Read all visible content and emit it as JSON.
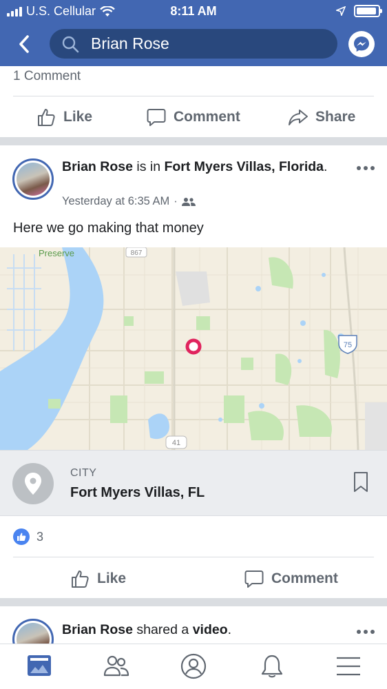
{
  "status_bar": {
    "carrier": "U.S. Cellular",
    "time": "8:11 AM",
    "icons": [
      "signal-icon",
      "wifi-icon",
      "location-icon",
      "battery-icon"
    ]
  },
  "header": {
    "search_value": "Brian Rose",
    "icons": [
      "back-icon",
      "search-icon",
      "messenger-icon"
    ]
  },
  "prev_post": {
    "comment_count": "1 Comment",
    "actions": [
      "Like",
      "Comment",
      "Share"
    ]
  },
  "post": {
    "author": "Brian Rose",
    "verb": " is in ",
    "location": "Fort Myers Villas, Florida",
    "location_suffix": ".",
    "time": "Yesterday at 6:35 AM",
    "separator": " · ",
    "audience_icon": "friends-icon",
    "text": "Here we go making that money",
    "map_labels": {
      "preserve": "Preserve",
      "road_867": "867",
      "road_75": "75",
      "road_41": "41"
    },
    "place": {
      "category": "CITY",
      "name": "Fort Myers Villas, FL"
    },
    "like_count": "3",
    "actions": [
      "Like",
      "Comment"
    ]
  },
  "next_post": {
    "author": "Brian Rose",
    "verb": " shared a ",
    "object": "video",
    "suffix": "."
  },
  "tabbar": {
    "tabs": [
      "news-feed-icon",
      "friends-icon",
      "profile-icon",
      "notifications-icon",
      "menu-icon"
    ]
  },
  "colors": {
    "brand": "#4267b2",
    "search_bg": "#29487d",
    "map_pin": "#e0245e",
    "secondary_text": "#606770"
  }
}
